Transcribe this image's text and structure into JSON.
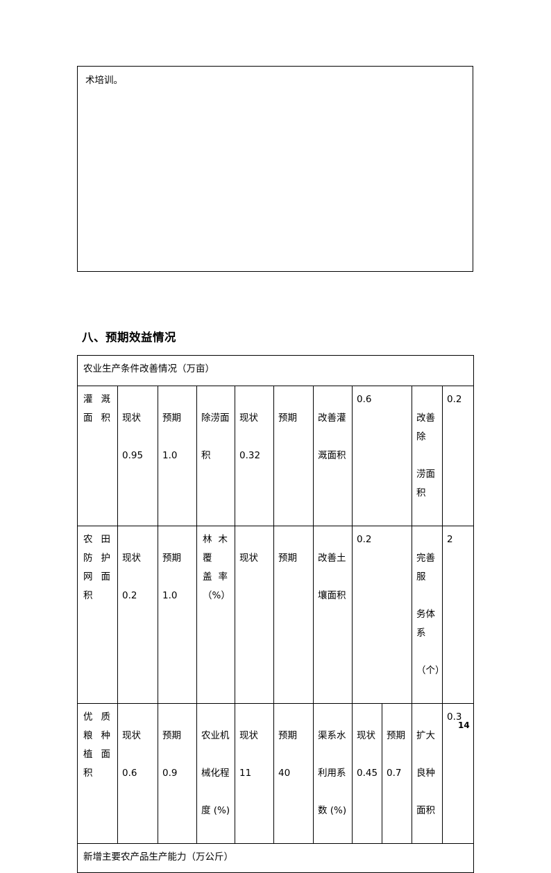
{
  "page": {
    "number": "14",
    "continuation_text": "术培训。"
  },
  "heading": {
    "text": "八、预期效益情况"
  },
  "table": {
    "banner_top": "农业生产条件改善情况（万亩）",
    "banner_bottom": "新增主要农产品生产能力（万公斤）",
    "rows": [
      {
        "label": "灌溉面积",
        "label_lines": [
          "灌 溉",
          "面 积"
        ],
        "current_header": "现状",
        "current_value": "0.95",
        "expected_header": "预期",
        "expected_value": "1.0",
        "label2": "除涝面积",
        "label2_lines": [
          "除涝面",
          "积"
        ],
        "current2_header": "现状",
        "current2_value": "0.32",
        "expected2_header": "预期",
        "expected2_value": "",
        "improve_label": "改善灌溉面积",
        "improve_label_lines": [
          "改善灌",
          "溉面积"
        ],
        "improve_value": "0.6",
        "improve2_label": "改善除涝面积",
        "improve2_label_lines": [
          "改善除",
          "涝面积"
        ],
        "improve2_value": "0.2"
      },
      {
        "label": "农田防护网面积",
        "label_lines": [
          "农 田",
          "防 护",
          "网 面",
          "积"
        ],
        "current_header": "现状",
        "current_value": "0.2",
        "expected_header": "预期",
        "expected_value": "1.0",
        "label2": "林木覆盖率（%）",
        "label2_lines": [
          "林木覆",
          "盖 率",
          "（%）"
        ],
        "current2_header": "现状",
        "current2_value": "",
        "expected2_header": "预期",
        "expected2_value": "",
        "improve_label": "改善土壤面积",
        "improve_label_lines": [
          "改善土",
          "壤面积"
        ],
        "improve_value": "0.2",
        "improve2_label": "完善服务体系（个）",
        "improve2_label_lines": [
          "完善服",
          "务体系",
          "（个）"
        ],
        "improve2_value": "2"
      },
      {
        "label": "优质粮种植面积",
        "label_lines": [
          "优 质",
          "粮 种",
          "植 面",
          "积"
        ],
        "current_header": "现状",
        "current_value": "0.6",
        "expected_header": "预期",
        "expected_value": "0.9",
        "label2": "农业机械化程度(%)",
        "label2_lines": [
          "农业机",
          "械化程",
          "度 (%)"
        ],
        "current2_header": "现状",
        "current2_value": "11",
        "expected2_header": "预期",
        "expected2_value": "40",
        "label3": "渠系水利用系数 (%)",
        "label3_lines": [
          "渠系水",
          "利用系",
          "数 (%)"
        ],
        "current3_header": "现状",
        "current3_value": "0.45",
        "expected3_header": "预期",
        "expected3_value": "0.7",
        "improve3_label": "扩大良种面积",
        "improve3_label_lines": [
          "扩大",
          "良种",
          "面积"
        ],
        "improve3_value": "0.3"
      }
    ]
  }
}
